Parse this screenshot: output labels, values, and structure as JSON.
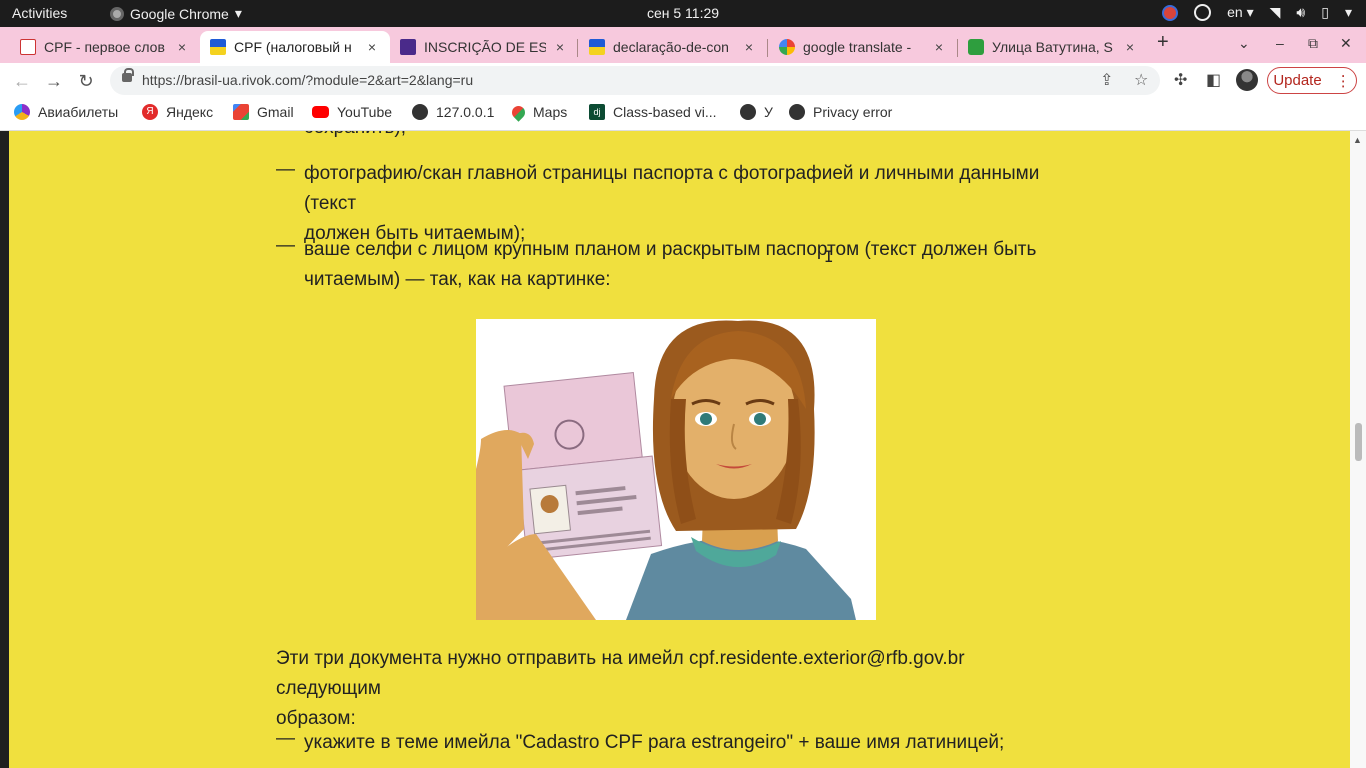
{
  "system_bar": {
    "activities": "Activities",
    "app_name": "Google Chrome",
    "clock": "сен 5  11:29",
    "lang": "en"
  },
  "tabs": [
    {
      "title": "CPF - первое слов",
      "active": false,
      "close": "×"
    },
    {
      "title": "CPF (налоговый н",
      "active": true,
      "close": "×"
    },
    {
      "title": "INSCRIÇÃO DE ES",
      "active": false,
      "close": "×"
    },
    {
      "title": "declaração-de-con",
      "active": false,
      "close": "×"
    },
    {
      "title": "google translate -",
      "active": false,
      "close": "×"
    },
    {
      "title": "Улица Ватутина, S",
      "active": false,
      "close": "×"
    }
  ],
  "toolbar": {
    "url": "https://brasil-ua.rivok.com/?module=2&art=2&lang=ru",
    "update_label": "Update"
  },
  "bookmarks": [
    {
      "label": "Авиабилеты",
      "icon": "aviasales-icon",
      "color": "#8b2fc9"
    },
    {
      "label": "Яндекс",
      "icon": "yandex-icon",
      "color": "#e22b2b"
    },
    {
      "label": "Gmail",
      "icon": "gmail-icon",
      "color": "#e94235"
    },
    {
      "label": "YouTube",
      "icon": "youtube-icon",
      "color": "#ff0000"
    },
    {
      "label": "127.0.0.1",
      "icon": "globe-icon",
      "color": "#333333"
    },
    {
      "label": "Maps",
      "icon": "maps-icon",
      "color": "#34a853"
    },
    {
      "label": "Class-based vi...",
      "icon": "django-icon",
      "color": "#0c4b33"
    },
    {
      "label": "У",
      "icon": "globe-icon",
      "color": "#333333"
    },
    {
      "label": "Privacy error",
      "icon": "globe-icon",
      "color": "#333333"
    }
  ],
  "article": {
    "cut_line": "сохранить);",
    "item1_line1": "фотографию/скан главной страницы паспорта с фотографией и личными данными (текст",
    "item1_line2": "должен быть читаемым);",
    "item2_line1": "ваше селфи с лицом крупным планом и раскрытым паспортом (текст должен быть",
    "item2_line2": "читаемым) — так, как на картинке:",
    "para_line1": "Эти три документа нужно отправить на имейл cpf.residente.exterior@rfb.gov.br следующим",
    "para_line2": "образом:",
    "item3": "укажите в теме имейла \"Cadastro CPF para estrangeiro\" + ваше имя латиницей;",
    "dash": "—"
  },
  "colors": {
    "page_bg": "#f0e03e",
    "tabstrip_bg": "#f7c9dd",
    "update_red": "#b3261e"
  }
}
